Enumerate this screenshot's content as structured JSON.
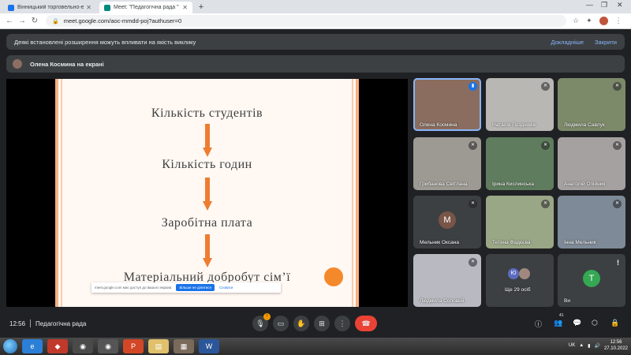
{
  "browser": {
    "tabs": [
      {
        "title": "Вінницький торговельно-економі",
        "color": "#1a73e8",
        "active": false
      },
      {
        "title": "Meet: \"Педагогічна рада \"",
        "color": "#00897b",
        "active": true
      }
    ],
    "url": "meet.google.com/aoc-mmdd-poj?authuser=0"
  },
  "banner": {
    "message": "Деякі встановлені розширення можуть впливати на якість виклику",
    "details_link": "Докладніше",
    "close_link": "Закрити"
  },
  "presenter": {
    "text": "Олена Космина на екрані"
  },
  "slide": {
    "lines": [
      "Кількість студентів",
      "Кількість годин",
      "Заробітна плата",
      "Матеріальний добробут сім’ї"
    ]
  },
  "share_bar": {
    "text": "meet.google.com має доступ до вашого екрана",
    "stop_label": "Більше не ділитися",
    "hide_label": "Сховати"
  },
  "participants": [
    {
      "name": "Олена Космина",
      "bg": "#8a6d5e",
      "mic": "active"
    },
    {
      "name": "Наталія Поздняків",
      "bg": "#b9b7b3",
      "mic": "muted"
    },
    {
      "name": "Людмила Савлук",
      "bg": "#7d8a6a",
      "mic": "muted"
    },
    {
      "name": "Грибанова Світлана",
      "bg": "#9d9a93",
      "mic": "muted"
    },
    {
      "name": "Ірина Кислинська",
      "bg": "#5f7d5e",
      "mic": "muted"
    },
    {
      "name": "Анатолій Опійник",
      "bg": "#a5a1a0",
      "mic": "muted"
    },
    {
      "name": "Мельник Оксана",
      "bg": "#3c4043",
      "mic": "muted",
      "letter": "М",
      "letter_bg": "#795548"
    },
    {
      "name": "Тетяна Фадєєва",
      "bg": "#9aa786",
      "mic": "muted"
    },
    {
      "name": "Інна Мельник",
      "bg": "#7e8a97",
      "mic": "muted"
    },
    {
      "name": "Людмила Соловей",
      "bg": "#b9b9c2",
      "mic": "muted"
    },
    {
      "name": "Ще 29 осіб",
      "bg": "#3c4043",
      "mic": "",
      "more": true
    },
    {
      "name": "Ви",
      "bg": "#3c4043",
      "mic": "",
      "letter": "T",
      "letter_bg": "#34a853",
      "self": true
    }
  ],
  "more_avatars": [
    {
      "text": "Ю",
      "bg": "#5c6bc0"
    },
    {
      "text": "",
      "bg": "#a1887f"
    }
  ],
  "controls": {
    "time": "12:56",
    "meeting_name": "Педагогічна рада",
    "mic_badge": "!",
    "participants_count": "41"
  },
  "taskbar": {
    "lang": "UK",
    "time": "12:56",
    "date": "27.10.2022"
  }
}
